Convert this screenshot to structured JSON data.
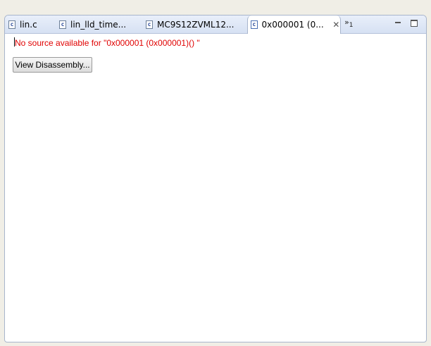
{
  "tabs": [
    {
      "icon": "c-file-icon",
      "icon_glyph": "c",
      "label": "lin.c"
    },
    {
      "icon": "c-file-icon",
      "icon_glyph": "c",
      "label": "lin_lld_time..."
    },
    {
      "icon": "c-file-icon",
      "icon_glyph": "c",
      "label": "MC9S12ZVML12..."
    },
    {
      "icon": "c-file-icon",
      "icon_glyph": "c",
      "label": "0x000001 (0...",
      "close": "✕",
      "active": true
    }
  ],
  "overflow": {
    "chevron": "»",
    "count": "1"
  },
  "window_controls": {
    "minimize": "minimize-icon",
    "maximize": "maximize-icon"
  },
  "editor": {
    "message": "No source available for \"0x000001 (0x000001)() \"",
    "button_label": "View Disassembly..."
  },
  "colors": {
    "message": "#e00000",
    "tab_bar": "#d6e1f3",
    "frame_border": "#a8b5cc"
  }
}
